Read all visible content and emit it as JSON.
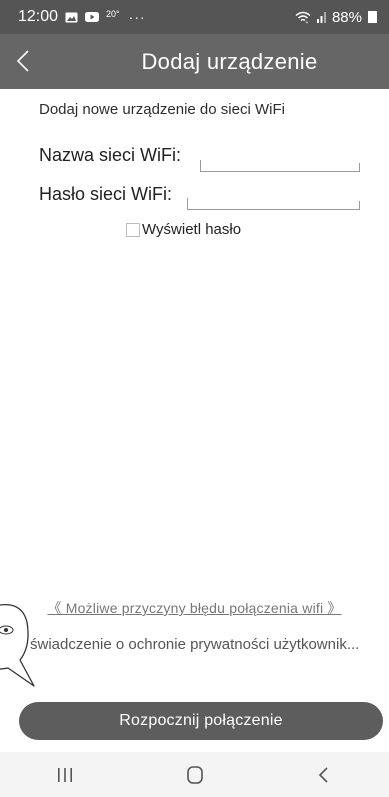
{
  "status_bar": {
    "time": "12:00",
    "temperature": "20°",
    "overflow_dots": "···",
    "battery_percent": "88%",
    "icons": [
      "gallery-icon",
      "youtube-icon",
      "wifi-icon",
      "signal-icon",
      "battery-icon"
    ]
  },
  "header": {
    "title": "Dodaj urządzenie",
    "back_icon": "chevron-left-icon",
    "background": "#666666"
  },
  "content": {
    "subtitle": "Dodaj nowe urządzenie do sieci WiFi",
    "ssid_label": "Nazwa sieci WiFi:",
    "ssid_value": "",
    "password_label": "Hasło sieci WiFi:",
    "password_value": "",
    "show_password_label": "Wyświetl hasło",
    "show_password_checked": false
  },
  "footer": {
    "reasons_link": "《 Możliwe przyczyny błędu połączenia wifi 》",
    "privacy_link": "świadczenie o ochronie prywatności użytkownik...",
    "connect_button": "Rozpocznij połączenie",
    "assistant_icon": "eye-bubble-icon"
  },
  "nav_bar": {
    "icons": [
      "recent-apps-icon",
      "home-icon",
      "back-icon"
    ]
  },
  "colors": {
    "status_bar": "#555555",
    "button": "#5d5d5d",
    "nav_bar": "#f4f4f4"
  }
}
